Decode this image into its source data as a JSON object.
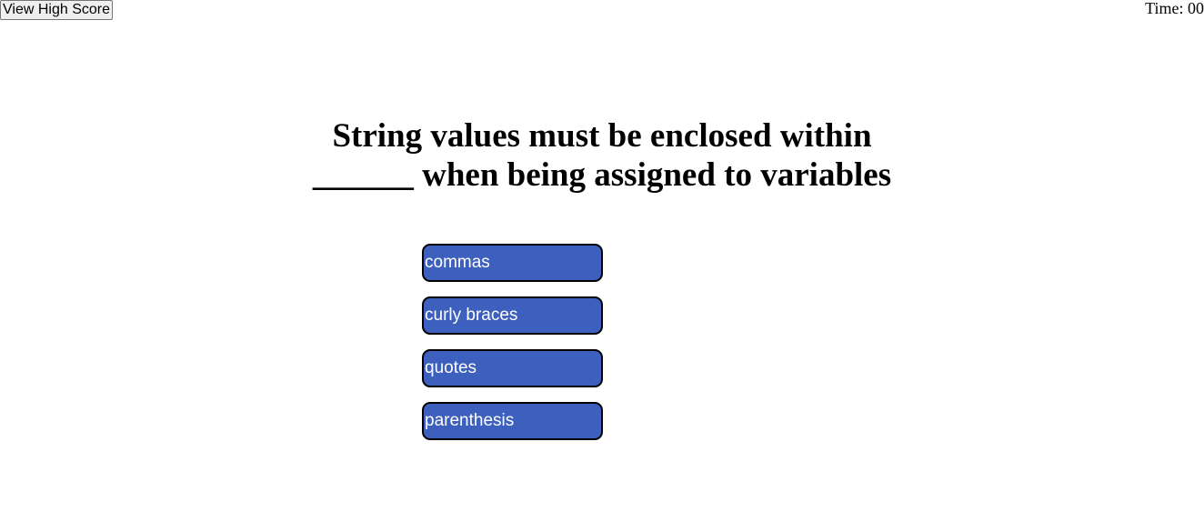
{
  "header": {
    "high_score_label": "View High Score",
    "timer_text": "Time: 00"
  },
  "question": {
    "text": "String values must be enclosed within ______ when being assigned to variables"
  },
  "answers": [
    {
      "label": "commas"
    },
    {
      "label": "curly braces"
    },
    {
      "label": "quotes"
    },
    {
      "label": "parenthesis"
    }
  ],
  "colors": {
    "answer_button_bg": "#3d5fbd",
    "answer_button_text": "#ffffff"
  }
}
